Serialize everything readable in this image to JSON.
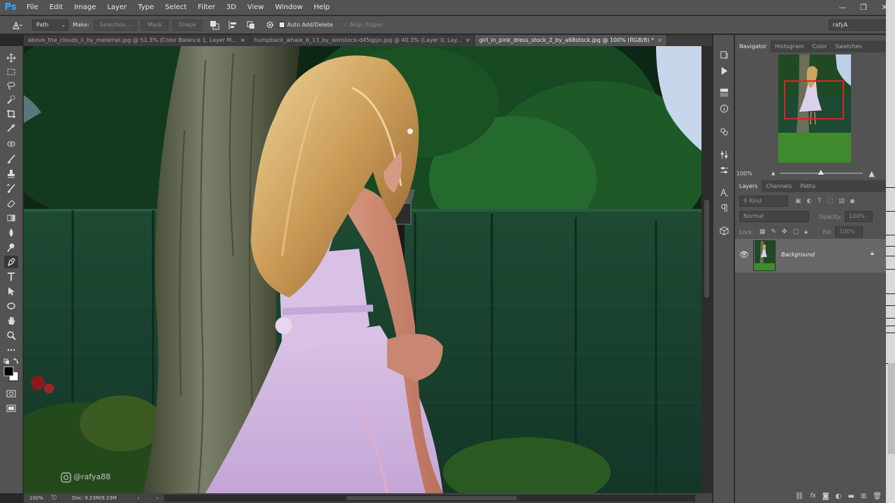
{
  "app": {
    "logo": "Ps"
  },
  "menu": [
    "File",
    "Edit",
    "Image",
    "Layer",
    "Type",
    "Select",
    "Filter",
    "3D",
    "View",
    "Window",
    "Help"
  ],
  "window_controls": {
    "minimize": "—",
    "restore": "❐",
    "close": "✕"
  },
  "options": {
    "mode": "Path",
    "make_label": "Make:",
    "selection": "Selection...",
    "mask": "Mask",
    "shape": "Shape",
    "auto_add_delete": "Auto Add/Delete",
    "align_edges": "Align Edges",
    "workspace": "rafyA"
  },
  "tabs": [
    {
      "label": "above_the_clouds_ii_by_melemel.jpg @ 51.3% (Color Balance 1, Layer M...",
      "active": false
    },
    {
      "label": "humpback_whale_6_13_by_donstock-d45qpjn.jpg @ 40.3% (Layer 0, Lay...",
      "active": false
    },
    {
      "label": "girl_in_pink_dress_stock_2_by_a68stock.jpg @ 100% (RGB/8) *",
      "active": true
    }
  ],
  "tab_close": "×",
  "canvas": {
    "watermark": "@rafya88"
  },
  "status": {
    "zoom": "100%",
    "doc": "Doc: 9.23M/9.23M"
  },
  "navigator": {
    "tabs": [
      "Navigator",
      "Histogram",
      "Color",
      "Swatches"
    ],
    "zoom": "100%",
    "viewport_box_color": "#e0202a"
  },
  "layers": {
    "tabs": [
      "Layers",
      "Channels",
      "Paths"
    ],
    "kind": "Kind",
    "blend_mode": "Normal",
    "opacity_label": "Opacity:",
    "opacity": "100%",
    "lock_label": "Lock:",
    "fill_label": "Fill:",
    "fill": "100%",
    "items": [
      {
        "name": "Background",
        "visible": true,
        "locked": true
      }
    ]
  },
  "colors": {
    "ui_bg": "#535353",
    "canvas_dark": "#282828",
    "accent_ps": "#31a8ff"
  }
}
